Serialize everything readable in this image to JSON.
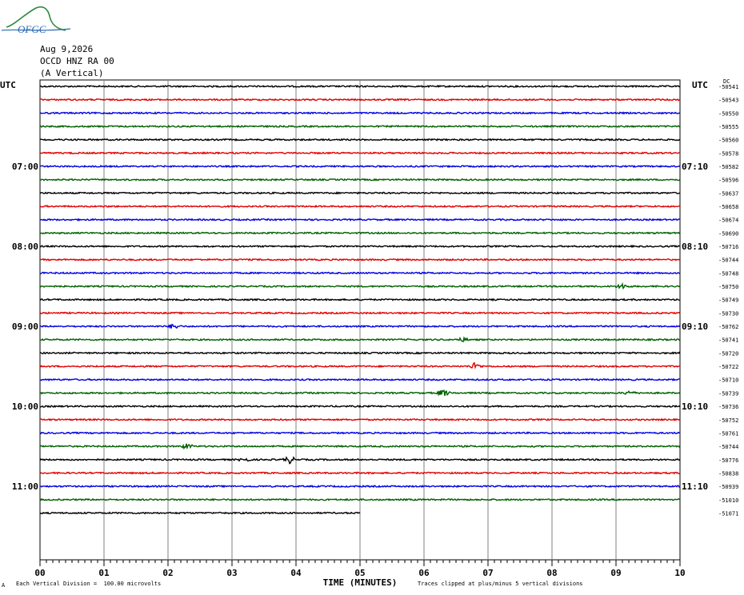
{
  "logo": {
    "text": "OFGC",
    "name": "ofgc-logo"
  },
  "header": {
    "date": "Aug 9,2026",
    "station": "OCCD HNZ RA 00",
    "component": "(A Vertical)"
  },
  "utc_left": "UTC",
  "utc_right": "UTC",
  "dc_label": "DC",
  "footer": {
    "scale_note": "Each Vertical Division =  100.00 microvolts",
    "clip_note": "Traces clipped at plus/minus 5 vertical divisions",
    "corner_mark": "A"
  },
  "chart_data": {
    "type": "line",
    "title": "",
    "xlabel": "TIME (MINUTES)",
    "ylabel": "",
    "xlim": [
      0,
      10
    ],
    "x_tick_labels": [
      "00",
      "01",
      "02",
      "03",
      "04",
      "05",
      "06",
      "07",
      "08",
      "09",
      "10"
    ],
    "grid": true,
    "trace_colors": [
      "#000000",
      "#e00000",
      "#0000e0",
      "#006000"
    ],
    "left_time_labels": [
      {
        "row": 6,
        "text": "07:00"
      },
      {
        "row": 12,
        "text": "08:00"
      },
      {
        "row": 18,
        "text": "09:00"
      },
      {
        "row": 24,
        "text": "10:00"
      },
      {
        "row": 30,
        "text": "11:00"
      }
    ],
    "right_time_labels": [
      {
        "row": 6,
        "text": "07:10"
      },
      {
        "row": 12,
        "text": "08:10"
      },
      {
        "row": 18,
        "text": "09:10"
      },
      {
        "row": 24,
        "text": "10:10"
      },
      {
        "row": 30,
        "text": "11:10"
      }
    ],
    "dc_offsets": [
      "-50541",
      "-50543",
      "-50550",
      "-50555",
      "-50560",
      "-50578",
      "-50582",
      "-50596",
      "-50637",
      "-50658",
      "-50674",
      "-50690",
      "-50716",
      "-50744",
      "-50748",
      "-50750",
      "-50749",
      "-50730",
      "-50762",
      "-50741",
      "-50720",
      "-50722",
      "-50710",
      "-50739",
      "-50736",
      "-50752",
      "-50761",
      "-50744",
      "-50776",
      "-50838",
      "-50939",
      "-51010",
      "-51071"
    ],
    "trace_end_minutes": [
      10,
      10,
      10,
      10,
      10,
      10,
      10,
      10,
      10,
      10,
      10,
      10,
      10,
      10,
      10,
      10,
      10,
      10,
      10,
      10,
      10,
      10,
      10,
      10,
      10,
      10,
      10,
      10,
      10,
      10,
      10,
      10,
      5
    ],
    "events": [
      {
        "row": 15,
        "minute": 9.1,
        "amp": 3
      },
      {
        "row": 18,
        "minute": 2.1,
        "amp": 3
      },
      {
        "row": 19,
        "minute": 6.6,
        "amp": 2
      },
      {
        "row": 21,
        "minute": 6.8,
        "amp": 4
      },
      {
        "row": 23,
        "minute": 6.3,
        "amp": 4
      },
      {
        "row": 23,
        "minute": 9.2,
        "amp": 2
      },
      {
        "row": 27,
        "minute": 2.3,
        "amp": 3
      },
      {
        "row": 28,
        "minute": 3.9,
        "amp": 4
      },
      {
        "row": 28,
        "minute": 3.2,
        "amp": 2
      }
    ]
  }
}
